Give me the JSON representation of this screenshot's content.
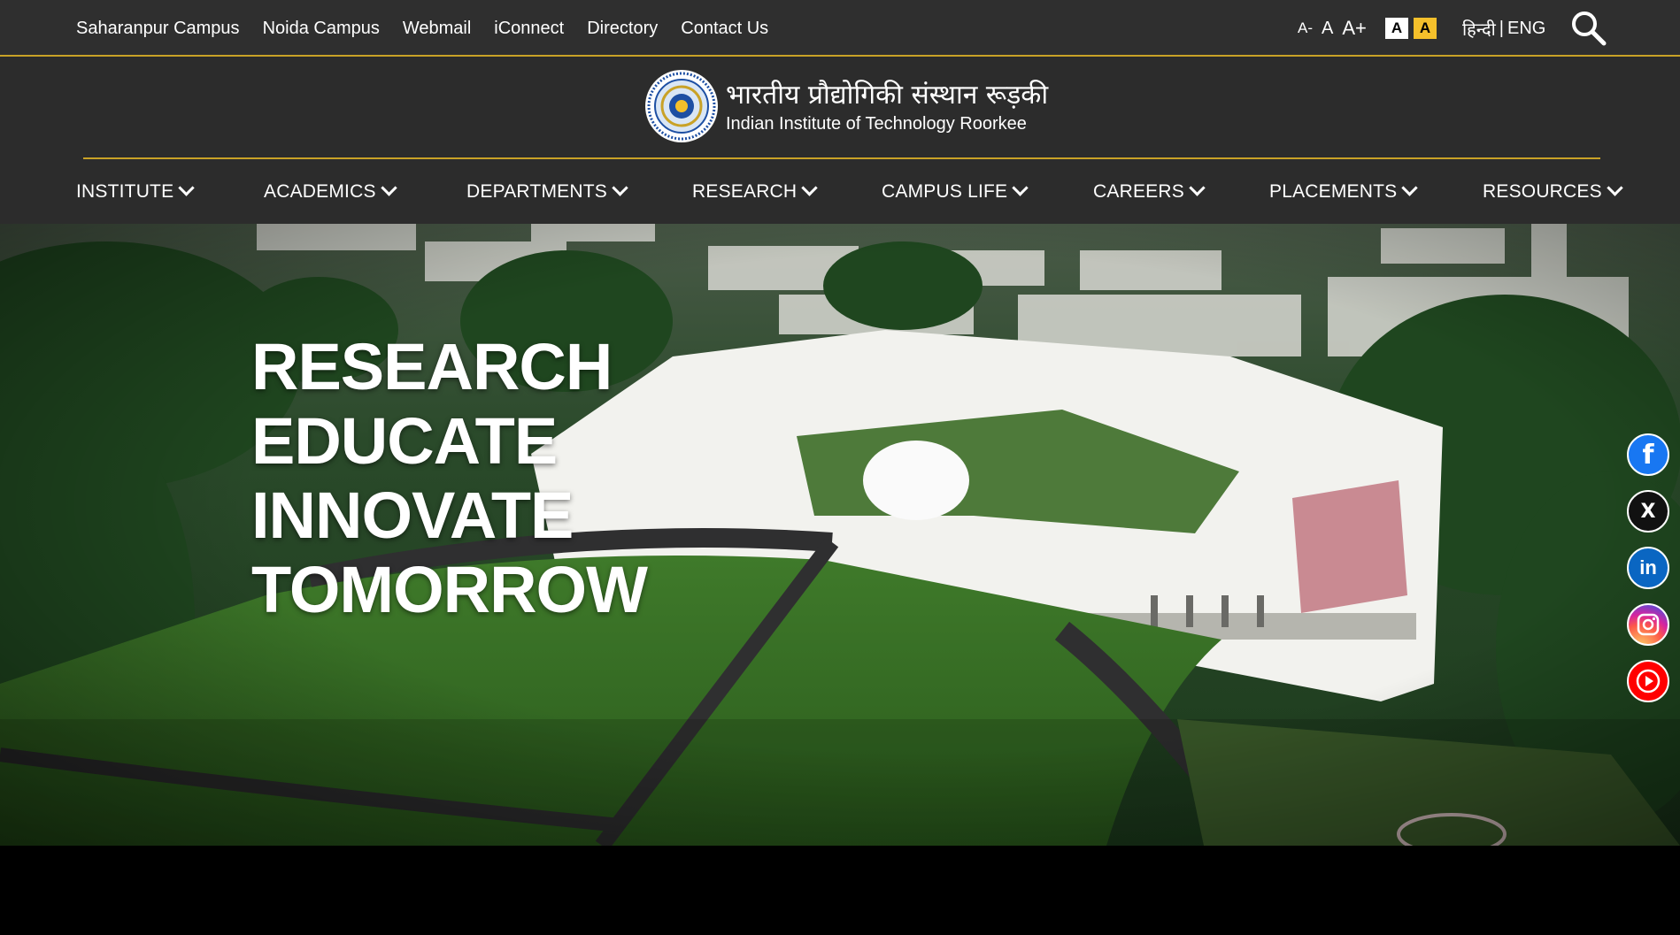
{
  "topbar": {
    "links": [
      "Saharanpur Campus",
      "Noida Campus",
      "Webmail",
      "iConnect",
      "Directory",
      "Contact Us"
    ],
    "font_controls": {
      "decrease": "A-",
      "normal": "A",
      "increase": "A+"
    },
    "contrast": {
      "white": "A",
      "yellow": "A"
    },
    "language": {
      "hindi": "हिन्दी",
      "separator": "|",
      "english": "ENG"
    },
    "search_icon": "search-icon"
  },
  "header": {
    "hindi_name": "भारतीय प्रौद्योगिकी संस्थान रूड़की",
    "english_name": "Indian Institute of Technology Roorkee"
  },
  "nav": {
    "items": [
      "INSTITUTE",
      "ACADEMICS",
      "DEPARTMENTS",
      "RESEARCH",
      "CAMPUS LIFE",
      "CAREERS",
      "PLACEMENTS",
      "RESOURCES"
    ]
  },
  "hero": {
    "lines": [
      "RESEARCH",
      "EDUCATE",
      "INNOVATE",
      "TOMORROW"
    ]
  },
  "social": {
    "facebook_glyph": "f",
    "x_glyph": "X",
    "linkedin_glyph": "in"
  },
  "colors": {
    "accent_gold": "#c9a227",
    "bar_bg": "#2f2f2f",
    "contrast_yellow": "#f5c02b"
  }
}
